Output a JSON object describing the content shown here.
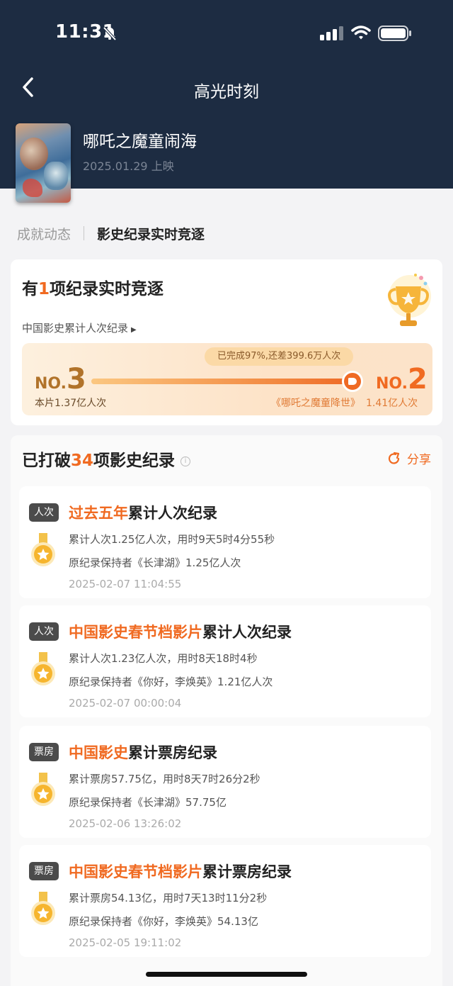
{
  "status_bar": {
    "time": "11:31"
  },
  "nav": {
    "title": "高光时刻"
  },
  "movie": {
    "title": "哪吒之魔童闹海",
    "release": "2025.01.29 上映"
  },
  "tabs": [
    {
      "label": "成就动态",
      "active": false
    },
    {
      "label": "影史纪录实时竞逐",
      "active": true
    }
  ],
  "realtime": {
    "head_prefix": "有",
    "count": "1",
    "head_suffix": "项纪录实时竞逐",
    "record_name": "中国影史累计人次纪录",
    "progress_tip": "已完成97%,还差399.6万人次",
    "progress_fraction": 0.97,
    "current_rank_prefix": "NO.",
    "current_rank": "3",
    "current_value": "本片1.37亿人次",
    "target_rank_prefix": "NO.",
    "target_rank": "2",
    "target_movie": "《哪吒之魔童降世》",
    "target_value": "1.41亿人次"
  },
  "broken": {
    "head_prefix": "已打破",
    "count": "34",
    "head_suffix": "项影史纪录",
    "info_icon": "ⓘ",
    "share_label": "分享"
  },
  "records": [
    {
      "tag": "人次",
      "title_hl": "过去五年",
      "title_rest": "累计人次纪录",
      "line1": "累计人次1.25亿人次，用时9天5时4分55秒",
      "line2": "原纪录保持者《长津湖》1.25亿人次",
      "time": "2025-02-07 11:04:55"
    },
    {
      "tag": "人次",
      "title_hl": "中国影史春节档影片",
      "title_rest": "累计人次纪录",
      "line1": "累计人次1.23亿人次，用时8天18时4秒",
      "line2": "原纪录保持者《你好，李焕英》1.21亿人次",
      "time": "2025-02-07 00:00:04"
    },
    {
      "tag": "票房",
      "title_hl": "中国影史",
      "title_rest": "累计票房纪录",
      "line1": "累计票房57.75亿，用时8天7时26分2秒",
      "line2": "原纪录保持者《长津湖》57.75亿",
      "time": "2025-02-06 13:26:02"
    },
    {
      "tag": "票房",
      "title_hl": "中国影史春节档影片",
      "title_rest": "累计票房纪录",
      "line1": "累计票房54.13亿，用时7天13时11分2秒",
      "line2": "原纪录保持者《你好，李焕英》54.13亿",
      "time": "2025-02-05 19:11:02"
    }
  ]
}
